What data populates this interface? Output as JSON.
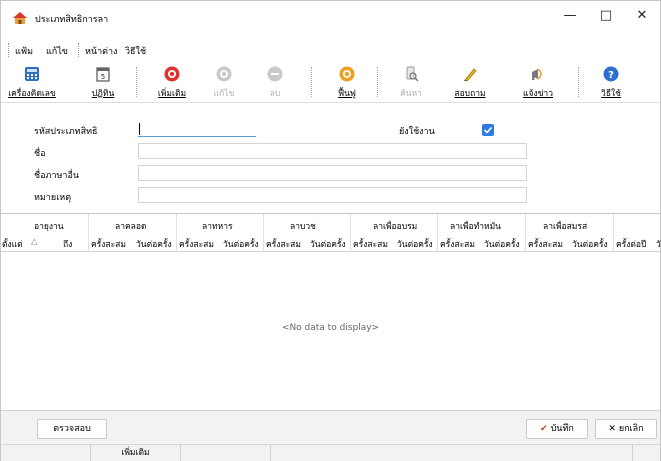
{
  "window": {
    "title": "ประเภทสิทธิการลา"
  },
  "menu": {
    "items": [
      "แฟ้ม",
      "แก้ไข",
      "หน้าต่าง",
      "วิธีใช้"
    ]
  },
  "toolbar": {
    "calculator": "เครื่องคิดเลข",
    "calendar": "ปฏิทิน",
    "add": "เพิ่มเติม",
    "edit": "แก้ไข",
    "delete": "ลบ",
    "refresh": "ฟื้นฟู",
    "search": "ค้นหา",
    "inquiry": "สอบถาม",
    "notify": "แจ้งข่าว",
    "help": "วิธีใช้"
  },
  "form": {
    "code_label": "รหัสประเภทสิทธิ",
    "name_label": "ชื่อ",
    "alt_name_label": "ชื่อภาษาอื่น",
    "note_label": "หมายเหตุ",
    "active_label": "ยังใช้งาน",
    "code_value": "",
    "name_value": "",
    "alt_name_value": "",
    "note_value": "",
    "active_checked": true
  },
  "grid": {
    "group_headers": [
      "อายุงาน",
      "ลาคลอด",
      "ลาทหาร",
      "ลาบวช",
      "ลาเพื่ออบรม",
      "ลาเพื่อทำหมัน",
      "ลาเพื่อสมรส"
    ],
    "sub_headers": [
      "ตั้งแต่",
      "ถึง",
      "ครั้งสะสม",
      "วันต่อครั้ง",
      "ครั้งสะสม",
      "วันต่อครั้ง",
      "ครั้งสะสม",
      "วันต่อครั้ง",
      "ครั้งสะสม",
      "วันต่อครั้ง",
      "ครั้งสะสม",
      "วันต่อครั้ง",
      "ครั้งสะสม",
      "วันต่อครั้ง",
      "ครั้งต่อปี",
      "วั"
    ],
    "empty_text": "<No data to display>"
  },
  "buttons": {
    "check": "ตรวจสอบ",
    "save": "บันทึก",
    "cancel": "ยกเลิก"
  },
  "status": {
    "mode": "เพิ่มเติม"
  },
  "colors": {
    "accent": "#2d7be5",
    "add_icon": "#e0312f",
    "refresh_icon": "#f0a020"
  }
}
